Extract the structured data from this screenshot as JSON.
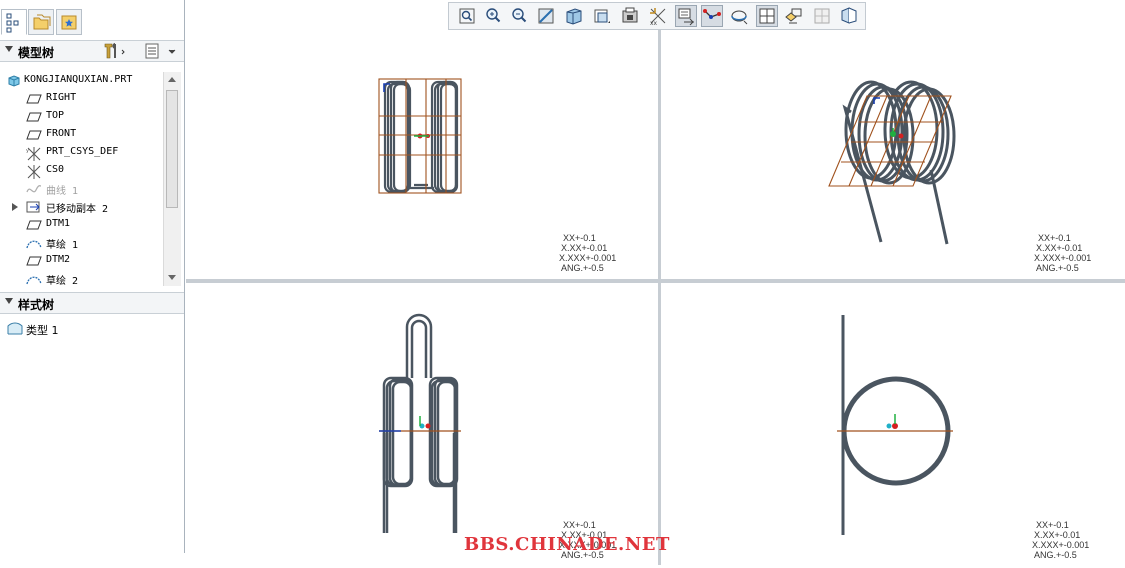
{
  "navigator": {
    "tabs": [
      {
        "name": "model-tree-tab-icon"
      },
      {
        "name": "folder-browser-tab-icon"
      },
      {
        "name": "favorites-tab-icon"
      }
    ],
    "model_tree": {
      "title": "模型树",
      "items": [
        {
          "label": "KONGJIANQUXIAN.PRT",
          "icon": "part-icon"
        },
        {
          "label": "RIGHT",
          "icon": "datum-plane-icon"
        },
        {
          "label": "TOP",
          "icon": "datum-plane-icon"
        },
        {
          "label": "FRONT",
          "icon": "datum-plane-icon"
        },
        {
          "label": "PRT_CSYS_DEF",
          "icon": "csys-icon"
        },
        {
          "label": "CS0",
          "icon": "csys-icon"
        },
        {
          "label": "曲线 1",
          "icon": "curve-icon"
        },
        {
          "label": "已移动副本 2",
          "icon": "moved-copy-icon"
        },
        {
          "label": "DTM1",
          "icon": "datum-plane-icon"
        },
        {
          "label": "草绘 1",
          "icon": "sketch-icon"
        },
        {
          "label": "DTM2",
          "icon": "datum-plane-icon"
        },
        {
          "label": "草绘 2",
          "icon": "sketch-icon"
        }
      ]
    },
    "style_tree": {
      "title": "样式树",
      "items": [
        {
          "label": "类型 1",
          "icon": "style-type-icon"
        }
      ]
    }
  },
  "toolbar": {
    "buttons": [
      {
        "name": "refit-icon"
      },
      {
        "name": "zoom-in-icon"
      },
      {
        "name": "zoom-out-icon"
      },
      {
        "name": "repaint-icon"
      },
      {
        "name": "shading-icon"
      },
      {
        "name": "saved-views-icon"
      },
      {
        "name": "view-manager-icon"
      },
      {
        "name": "datum-display-icon"
      },
      {
        "name": "spin-center-icon"
      },
      {
        "name": "annotation-display-icon"
      },
      {
        "name": "orient-icon"
      },
      {
        "name": "split-views-icon"
      },
      {
        "name": "layer-icon"
      },
      {
        "name": "section-icon"
      },
      {
        "name": "appearance-icon"
      }
    ],
    "active": [
      "spin-center-icon",
      "annotation-display-icon",
      "split-views-icon"
    ]
  },
  "tolerances": [
    "XX+-0.1",
    "X.XX+-0.01",
    "X.XXX+-0.001",
    "ANG.+-0.5"
  ],
  "watermark": "BBS.CHINADE.NET",
  "colors": {
    "wire": "#4a5560",
    "datum_plane": "#a0521e",
    "csys_red": "#d42020",
    "csys_green": "#20b040",
    "accent_blue": "#1a3fb0"
  }
}
